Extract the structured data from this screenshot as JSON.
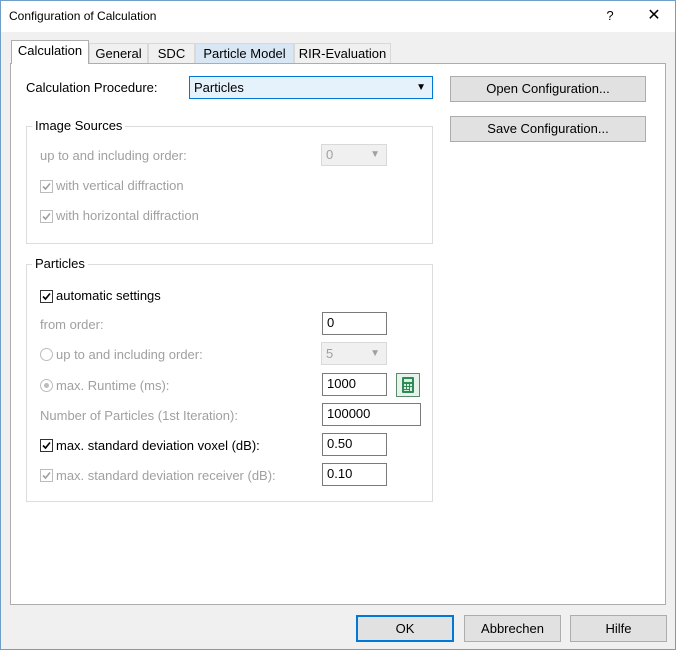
{
  "window": {
    "title": "Configuration of Calculation",
    "help_glyph": "?",
    "close_glyph": "✕"
  },
  "tabs": [
    {
      "label": "Calculation"
    },
    {
      "label": "General"
    },
    {
      "label": "SDC"
    },
    {
      "label": "Particle Model"
    },
    {
      "label": "RIR-Evaluation"
    }
  ],
  "calculation": {
    "procedure_label": "Calculation Procedure:",
    "procedure_value": "Particles",
    "open_config_label": "Open Configuration...",
    "save_config_label": "Save Configuration..."
  },
  "image_sources": {
    "title": "Image Sources",
    "order_label": "up to and including order:",
    "order_value": "0",
    "vertical_diffraction": {
      "label": "with vertical diffraction",
      "checked": true,
      "enabled": false
    },
    "horizontal_diffraction": {
      "label": "with horizontal diffraction",
      "checked": true,
      "enabled": false
    }
  },
  "particles": {
    "title": "Particles",
    "automatic_settings": {
      "label": "automatic settings",
      "checked": true
    },
    "from_order_label": "from order:",
    "from_order_value": "0",
    "up_to_order_label": "up to and including order:",
    "up_to_order_value": "5",
    "max_runtime_label": "max. Runtime (ms):",
    "max_runtime_value": "1000",
    "num_particles_label": "Number of Particles (1st Iteration):",
    "num_particles_value": "100000",
    "std_dev_voxel": {
      "label": "max. standard deviation voxel (dB):",
      "value": "0.50",
      "checked": true
    },
    "std_dev_receiver": {
      "label": "max. standard deviation receiver (dB):",
      "value": "0.10",
      "checked": true
    }
  },
  "footer": {
    "ok_label": "OK",
    "cancel_label": "Abbrechen",
    "help_label": "Hilfe"
  },
  "colors": {
    "focus": "#0078d7",
    "tab_highlight": "#d9e7f5",
    "calc_icon": "#2e8b57"
  }
}
